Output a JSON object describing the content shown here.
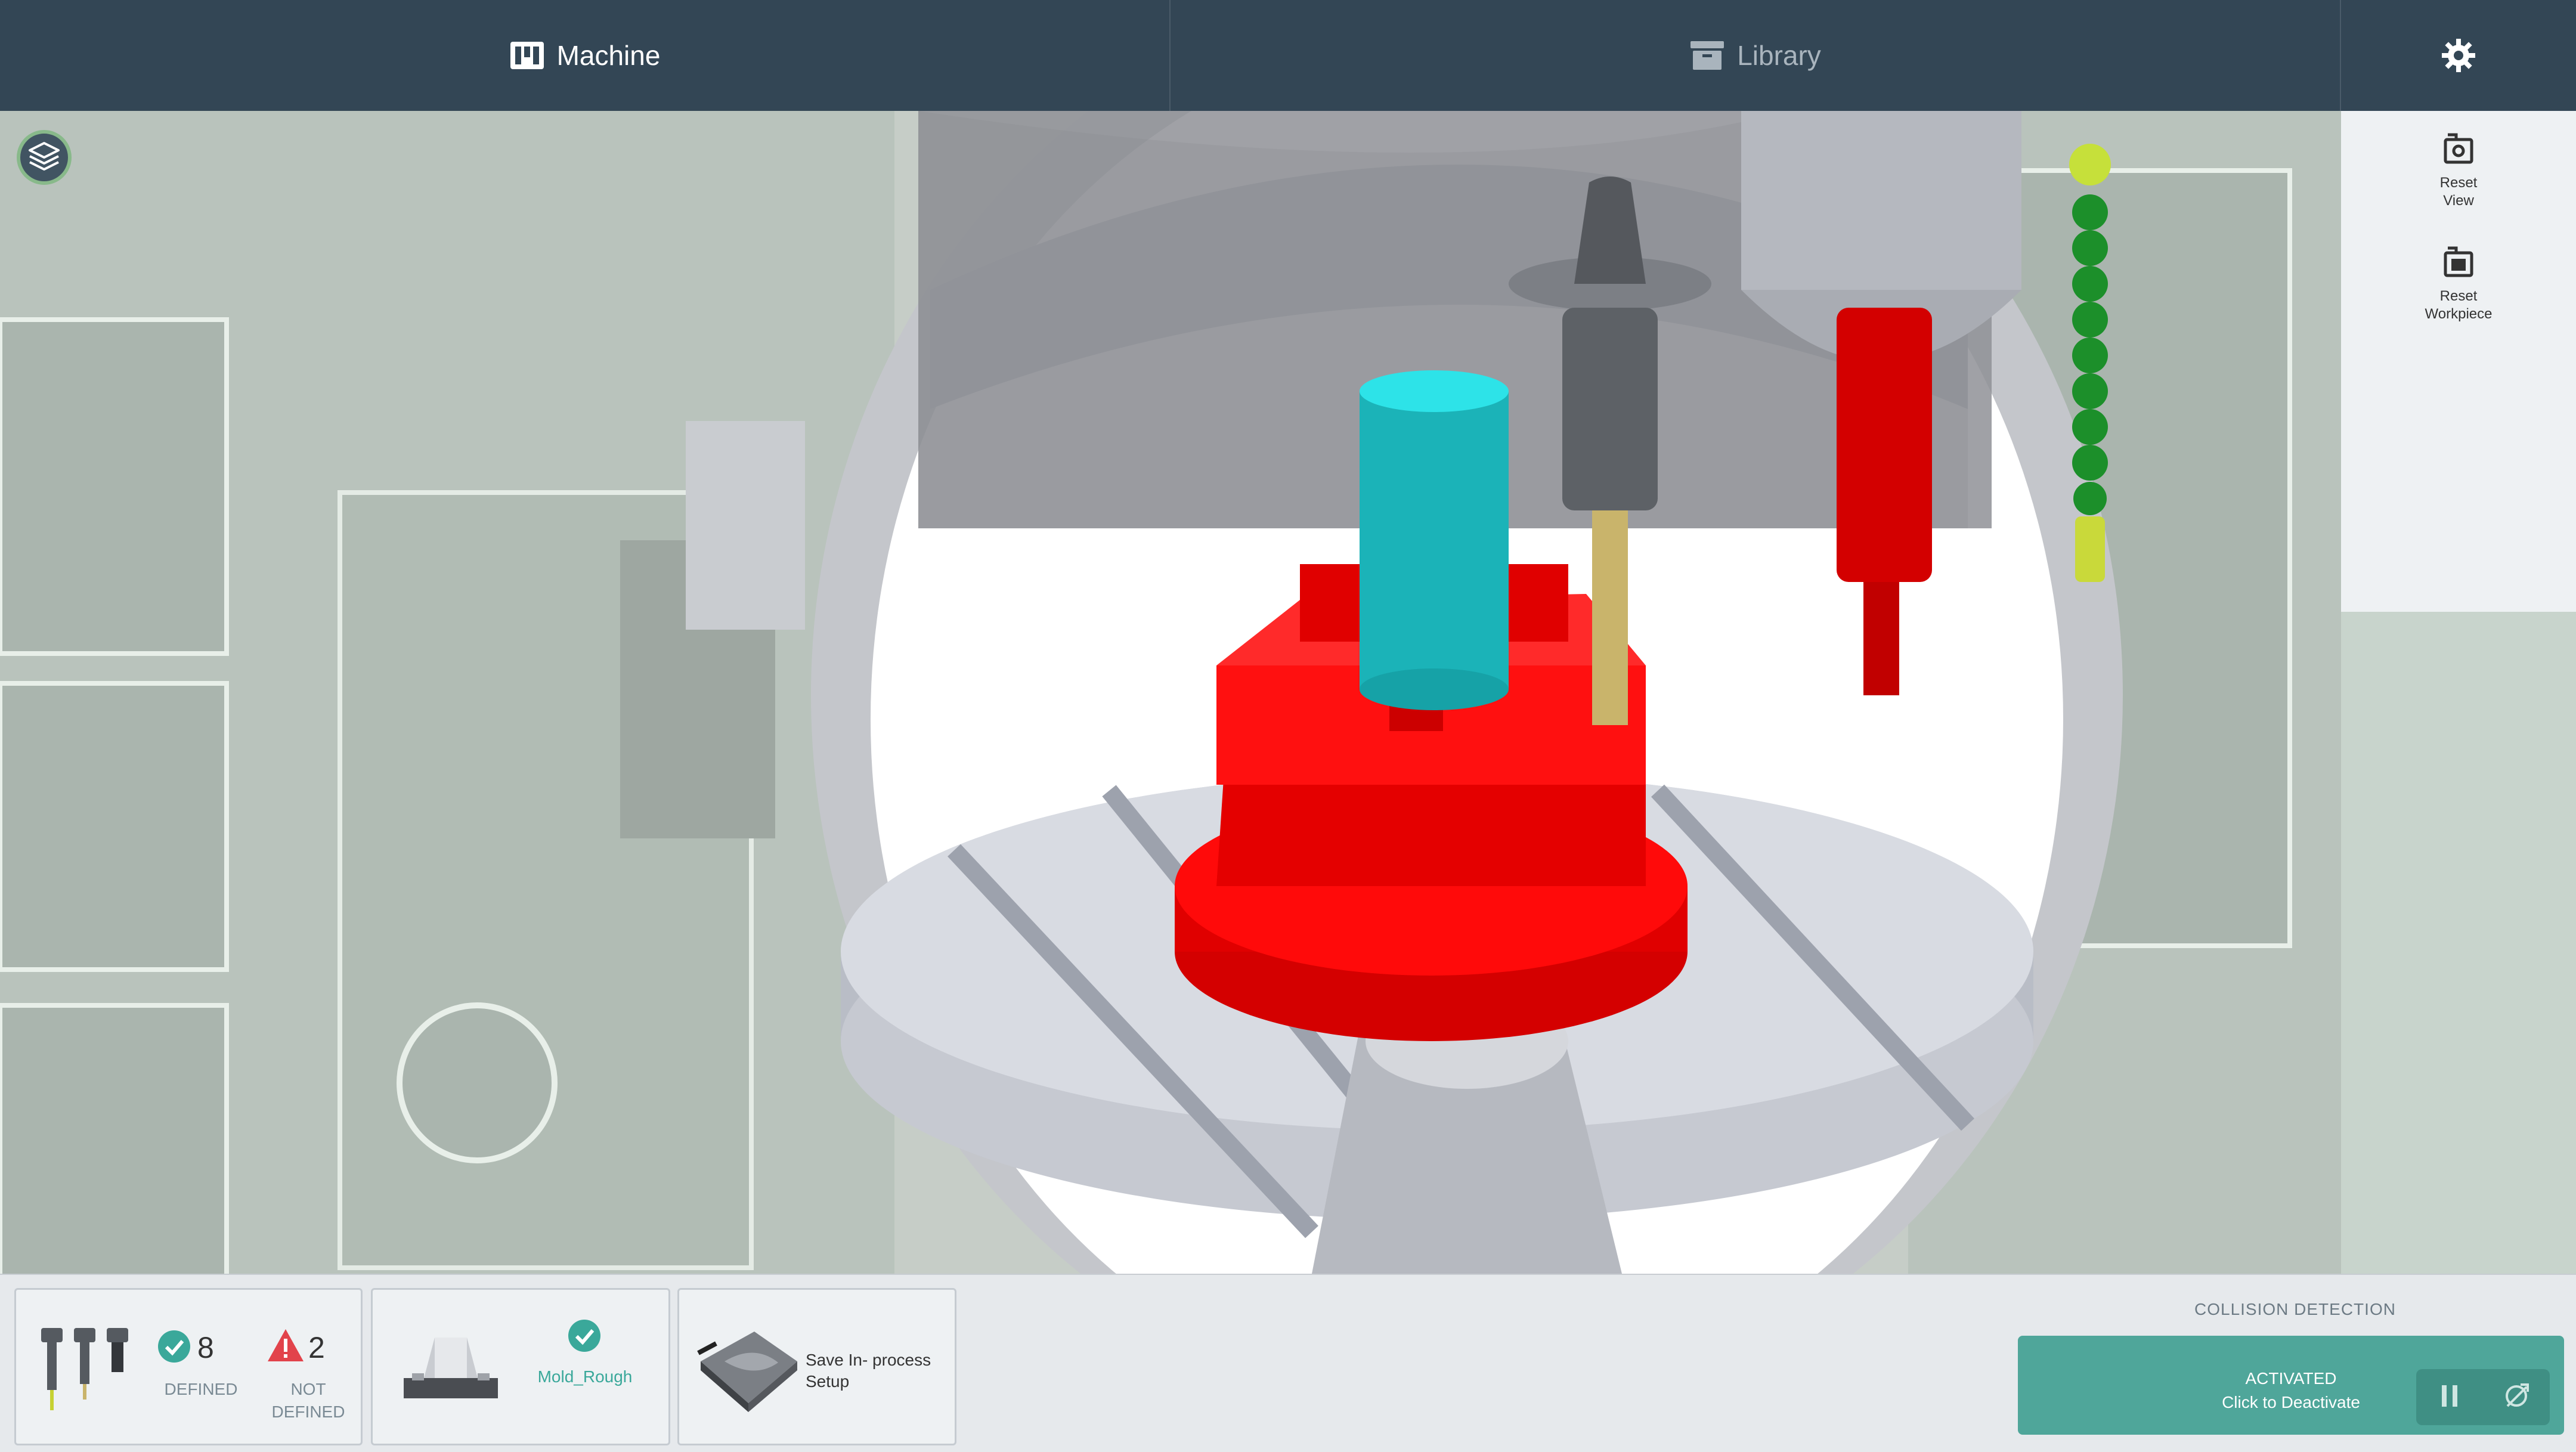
{
  "tabs": {
    "machine": "Machine",
    "library": "Library"
  },
  "icons": {
    "machine": "machine-icon",
    "library": "library-icon",
    "settings": "gear-icon",
    "layers": "layers-icon",
    "reset_view": "reset-view-icon",
    "reset_workpiece": "reset-workpiece-icon",
    "defined": "check-circle-icon",
    "not_defined": "warning-triangle-icon",
    "pause": "pause-icon",
    "collision": "collision-icon"
  },
  "right_panel": {
    "reset_view": "Reset View",
    "reset_workpiece": "Reset Workpiece"
  },
  "tools": {
    "defined_count": "8",
    "defined_label": "DEFINED",
    "not_defined_count": "2",
    "not_defined_label": "NOT DEFINED"
  },
  "setup": {
    "name": "Mold_Rough"
  },
  "save": {
    "label": "Save In- process Setup"
  },
  "collision": {
    "title": "COLLISION DETECTION",
    "status": "ACTIVATED",
    "action": "Click to Deactivate"
  },
  "colors": {
    "topbar": "#334655",
    "accent": "#4fa69a",
    "warning": "#e2434b",
    "check": "#3aa89a"
  }
}
